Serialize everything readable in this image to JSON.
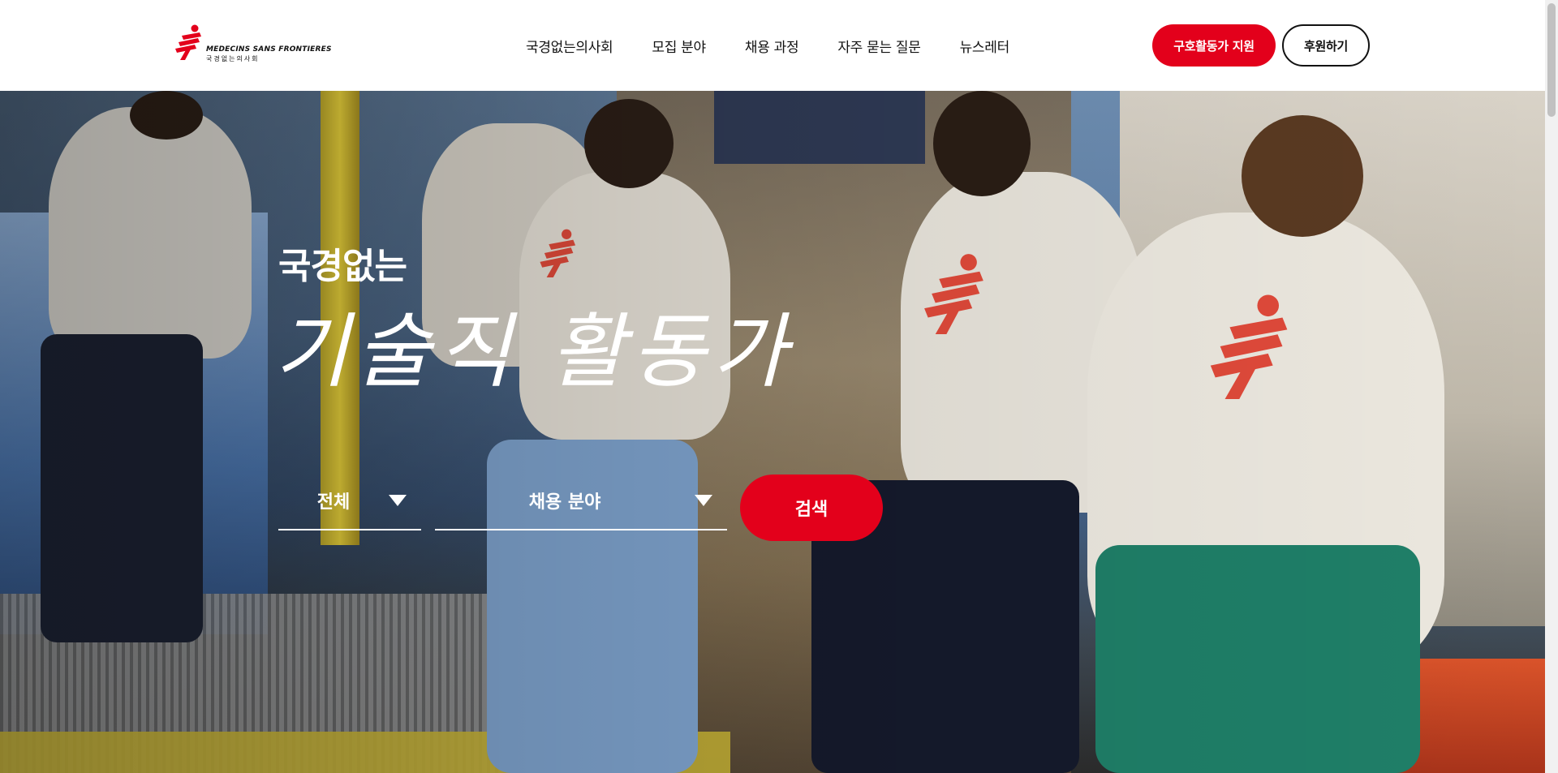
{
  "header": {
    "logo_name": "MEDECINS SANS FRONTIERES",
    "logo_korean": "국경없는의사회",
    "nav": [
      {
        "label": "국경없는의사회"
      },
      {
        "label": "모집 분야"
      },
      {
        "label": "채용 과정"
      },
      {
        "label": "자주 묻는 질문"
      },
      {
        "label": "뉴스레터"
      }
    ],
    "apply_label": "구호활동가 지원",
    "donate_label": "후원하기"
  },
  "hero": {
    "subtitle": "국경없는",
    "title": "기술직 활동가",
    "filter_all": "전체",
    "filter_field": "채용 분야",
    "search_label": "검색"
  },
  "colors": {
    "brand_red": "#e3001b",
    "text_dark": "#111111"
  }
}
